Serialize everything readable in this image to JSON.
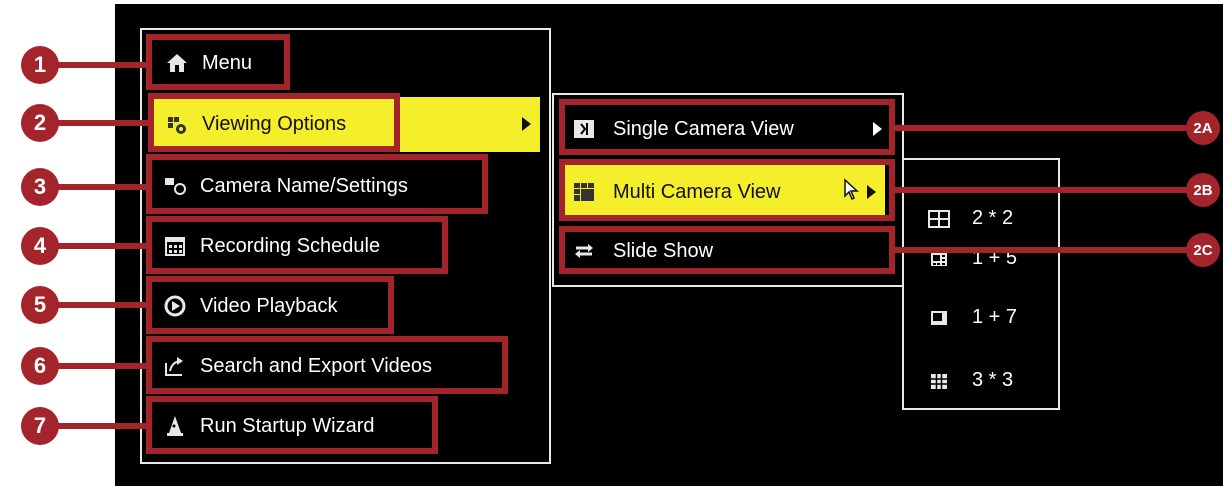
{
  "main_menu": {
    "items": [
      {
        "label": "Menu",
        "icon": "home-icon"
      },
      {
        "label": "Viewing Options",
        "icon": "viewing-options-icon",
        "highlighted": true
      },
      {
        "label": "Camera Name/Settings",
        "icon": "camera-icon"
      },
      {
        "label": "Recording Schedule",
        "icon": "calendar-icon"
      },
      {
        "label": "Video Playback",
        "icon": "playback-icon"
      },
      {
        "label": "Search and Export Videos",
        "icon": "export-icon"
      },
      {
        "label": "Run Startup Wizard",
        "icon": "wizard-icon"
      }
    ]
  },
  "viewing_submenu": {
    "items": [
      {
        "label": "Single Camera View",
        "icon": "single-camera-icon"
      },
      {
        "label": "Multi Camera View",
        "icon": "multi-camera-icon",
        "highlighted": true
      },
      {
        "label": "Slide Show",
        "icon": "slideshow-icon"
      }
    ]
  },
  "layout_submenu": {
    "items": [
      {
        "label": "2 * 2",
        "icon": "grid-2x2-icon"
      },
      {
        "label": "1 + 5",
        "icon": "grid-1plus5-icon"
      },
      {
        "label": "1 + 7",
        "icon": "grid-1plus7-icon"
      },
      {
        "label": "3 * 3",
        "icon": "grid-3x3-icon"
      }
    ]
  },
  "callouts": [
    "1",
    "2",
    "3",
    "4",
    "5",
    "6",
    "7",
    "2A",
    "2B",
    "2C"
  ],
  "colors": {
    "highlight": "#f5ee2a",
    "callout": "#a3242b",
    "screen": "#000000",
    "border": "#e8e8e8"
  }
}
